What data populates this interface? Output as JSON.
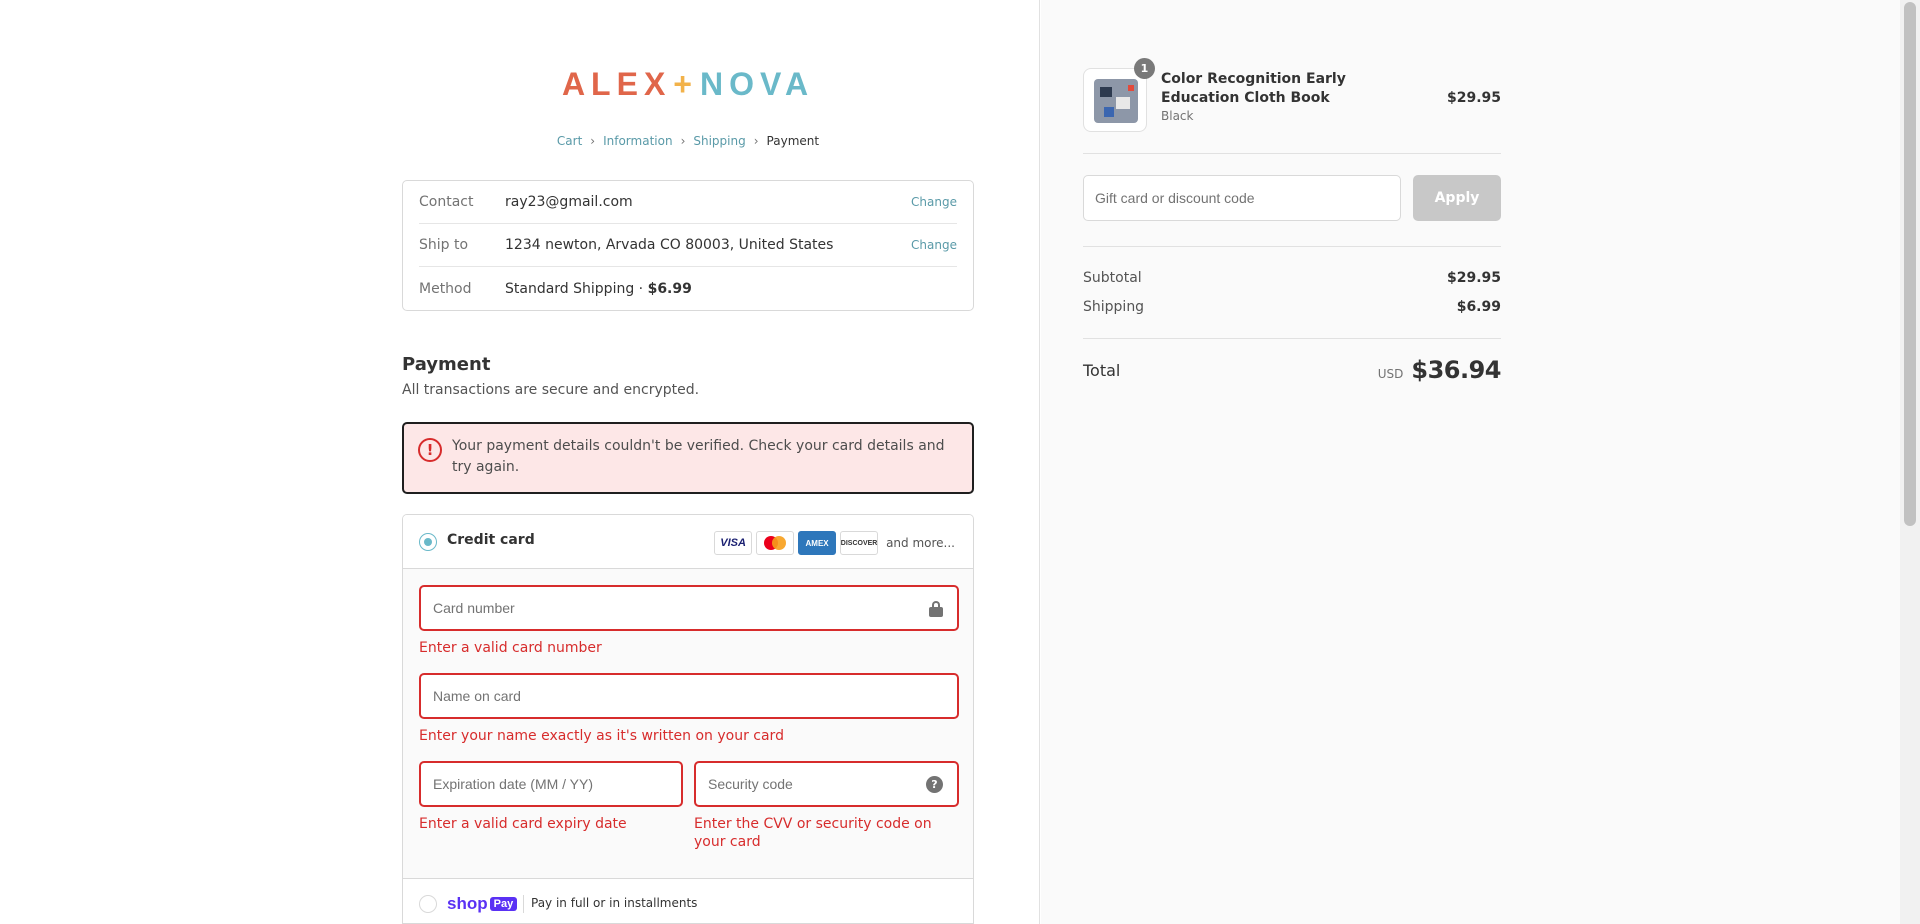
{
  "brand": {
    "part1": "ALEX",
    "plus": "+",
    "part2": "NOVA"
  },
  "breadcrumb": [
    {
      "label": "Cart"
    },
    {
      "label": "Information"
    },
    {
      "label": "Shipping"
    },
    {
      "label": "Payment"
    }
  ],
  "review": {
    "contact_label": "Contact",
    "contact_value": "ray23@gmail.com",
    "ship_label": "Ship to",
    "ship_value": "1234 newton, Arvada CO 80003, United States",
    "method_label": "Method",
    "method_name": "Standard Shipping",
    "method_dot": " · ",
    "method_price": "$6.99",
    "change_label": "Change"
  },
  "payment": {
    "title": "Payment",
    "subtitle": "All transactions are secure and encrypted.",
    "error_icon": "!",
    "error_message": "Your payment details couldn't be verified. Check your card details and try again.",
    "credit_card_label": "Credit card",
    "brands": {
      "visa": "VISA",
      "amex": "AMEX",
      "discover": "DISCOVER"
    },
    "and_more": "and more...",
    "card_number_placeholder": "Card number",
    "card_number_error": "Enter a valid card number",
    "name_placeholder": "Name on card",
    "name_error": "Enter your name exactly as it's written on your card",
    "expiry_placeholder": "Expiration date (MM / YY)",
    "expiry_error": "Enter a valid card expiry date",
    "cvv_placeholder": "Security code",
    "cvv_help": "?",
    "cvv_error": "Enter the CVV or security code on your card",
    "shop_logo": "shop",
    "shop_pay_badge": "Pay",
    "shop_pay_text": "Pay in full or in installments"
  },
  "summary": {
    "quantity": "1",
    "product_name": "Color Recognition Early Education Cloth Book",
    "product_variant": "Black",
    "product_price": "$29.95",
    "discount_placeholder": "Gift card or discount code",
    "apply_label": "Apply",
    "subtotal_label": "Subtotal",
    "subtotal_value": "$29.95",
    "shipping_label": "Shipping",
    "shipping_value": "$6.99",
    "total_label": "Total",
    "currency": "USD",
    "total_value": "$36.94"
  },
  "colors": {
    "accent": "#6ab9c9",
    "error": "#d72c2c",
    "brand_orange": "#e0664a",
    "shop_pay": "#5a31f4"
  },
  "icons": [
    "chevron-right-icon",
    "alert-circle-icon",
    "lock-icon",
    "question-circle-icon",
    "mastercard-icon"
  ]
}
